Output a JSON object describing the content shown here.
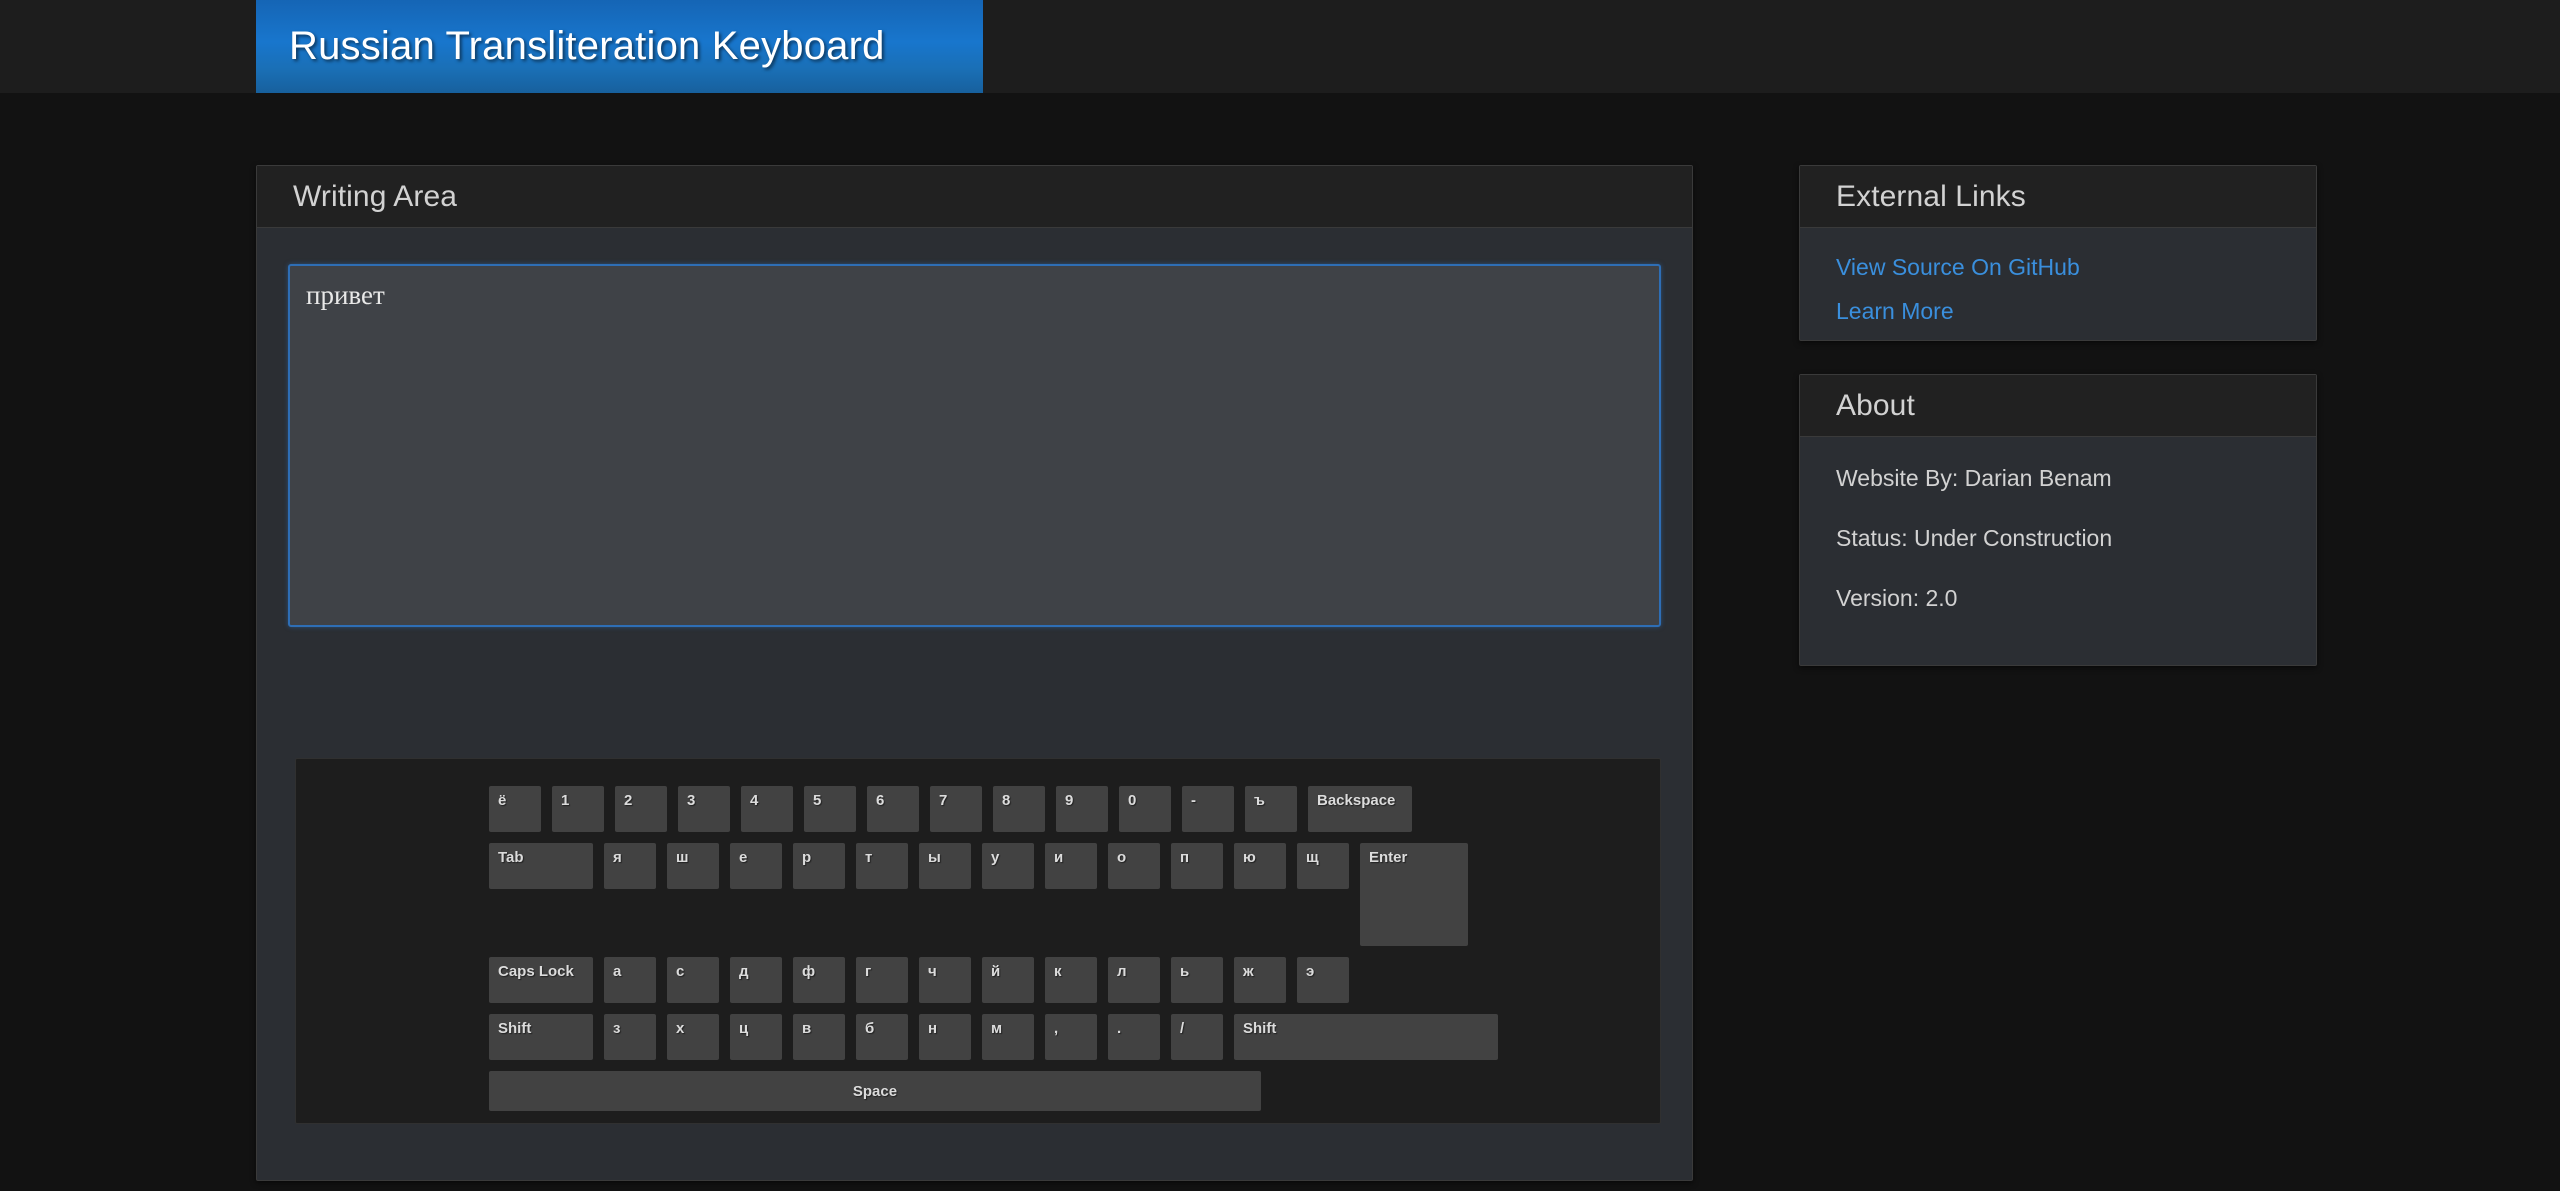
{
  "banner": {
    "title": "Russian Transliteration Keyboard"
  },
  "writing_panel": {
    "header": "Writing Area",
    "textarea": {
      "value": "привет",
      "placeholder": ""
    }
  },
  "keyboard": {
    "rows": [
      {
        "name": "number-row",
        "keys": [
          {
            "label": "ё",
            "type": "char"
          },
          {
            "label": "1",
            "type": "char"
          },
          {
            "label": "2",
            "type": "char"
          },
          {
            "label": "3",
            "type": "char"
          },
          {
            "label": "4",
            "type": "char"
          },
          {
            "label": "5",
            "type": "char"
          },
          {
            "label": "6",
            "type": "char"
          },
          {
            "label": "7",
            "type": "char"
          },
          {
            "label": "8",
            "type": "char"
          },
          {
            "label": "9",
            "type": "char"
          },
          {
            "label": "0",
            "type": "char"
          },
          {
            "label": "-",
            "type": "char"
          },
          {
            "label": "ъ",
            "type": "char"
          },
          {
            "label": "Backspace",
            "type": "wide"
          }
        ]
      },
      {
        "name": "top-row",
        "keys": [
          {
            "label": "Tab",
            "type": "wide"
          },
          {
            "label": "я",
            "type": "char"
          },
          {
            "label": "ш",
            "type": "char"
          },
          {
            "label": "е",
            "type": "char"
          },
          {
            "label": "р",
            "type": "char"
          },
          {
            "label": "т",
            "type": "char"
          },
          {
            "label": "ы",
            "type": "char"
          },
          {
            "label": "у",
            "type": "char"
          },
          {
            "label": "и",
            "type": "char"
          },
          {
            "label": "о",
            "type": "char"
          },
          {
            "label": "п",
            "type": "char"
          },
          {
            "label": "ю",
            "type": "char"
          },
          {
            "label": "щ",
            "type": "char"
          },
          {
            "label": "Enter",
            "type": "enter"
          }
        ]
      },
      {
        "name": "home-row",
        "keys": [
          {
            "label": "Caps Lock",
            "type": "wide"
          },
          {
            "label": "а",
            "type": "char"
          },
          {
            "label": "с",
            "type": "char"
          },
          {
            "label": "д",
            "type": "char"
          },
          {
            "label": "ф",
            "type": "char"
          },
          {
            "label": "г",
            "type": "char"
          },
          {
            "label": "ч",
            "type": "char"
          },
          {
            "label": "й",
            "type": "char"
          },
          {
            "label": "к",
            "type": "char"
          },
          {
            "label": "л",
            "type": "char"
          },
          {
            "label": "ь",
            "type": "char"
          },
          {
            "label": "ж",
            "type": "char"
          },
          {
            "label": "э",
            "type": "char"
          }
        ]
      },
      {
        "name": "bottom-row",
        "keys": [
          {
            "label": "Shift",
            "type": "wide"
          },
          {
            "label": "з",
            "type": "char"
          },
          {
            "label": "х",
            "type": "char"
          },
          {
            "label": "ц",
            "type": "char"
          },
          {
            "label": "в",
            "type": "char"
          },
          {
            "label": "б",
            "type": "char"
          },
          {
            "label": "н",
            "type": "char"
          },
          {
            "label": "м",
            "type": "char"
          },
          {
            "label": ",",
            "type": "char"
          },
          {
            "label": ".",
            "type": "char"
          },
          {
            "label": "/",
            "type": "char"
          },
          {
            "label": "Shift",
            "type": "shiftr"
          }
        ]
      },
      {
        "name": "space-row",
        "keys": [
          {
            "label": "Space",
            "type": "space"
          }
        ]
      }
    ]
  },
  "external_links": {
    "header": "External Links",
    "links": [
      {
        "label": "View Source On GitHub"
      },
      {
        "label": "Learn More"
      }
    ]
  },
  "about": {
    "header": "About",
    "lines": [
      "Website By: Darian Benam",
      "Status: Under Construction",
      "Version: 2.0"
    ]
  },
  "colors": {
    "accent_blue": "#1876cd",
    "link_blue": "#3a8fdd",
    "panel_bg": "#2b2e33",
    "panel_header_bg": "#212121",
    "key_bg": "#424242",
    "page_bg": "#121212"
  }
}
